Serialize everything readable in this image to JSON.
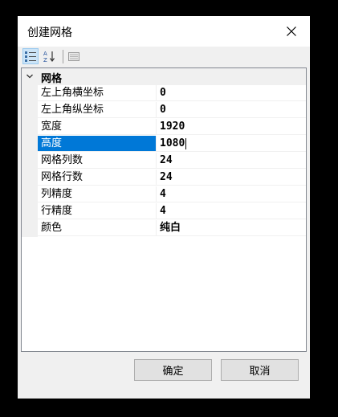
{
  "window": {
    "title": "创建网格"
  },
  "grid": {
    "category": "网格",
    "rows": [
      {
        "name": "左上角横坐标",
        "value": "0"
      },
      {
        "name": "左上角纵坐标",
        "value": "0"
      },
      {
        "name": "宽度",
        "value": "1920"
      },
      {
        "name": "高度",
        "value": "1080"
      },
      {
        "name": "网格列数",
        "value": "24"
      },
      {
        "name": "网格行数",
        "value": "24"
      },
      {
        "name": "列精度",
        "value": "4"
      },
      {
        "name": "行精度",
        "value": "4"
      },
      {
        "name": "颜色",
        "value": "纯白"
      }
    ],
    "selected_row": "高度"
  },
  "buttons": {
    "ok": "确定",
    "cancel": "取消"
  },
  "colors": {
    "selection": "#0078d7",
    "window_bg": "#f0f0f0"
  },
  "icons": [
    "close-icon",
    "categorized-view-icon",
    "alphabetical-sort-icon",
    "property-pages-icon",
    "chevron-down-icon"
  ]
}
